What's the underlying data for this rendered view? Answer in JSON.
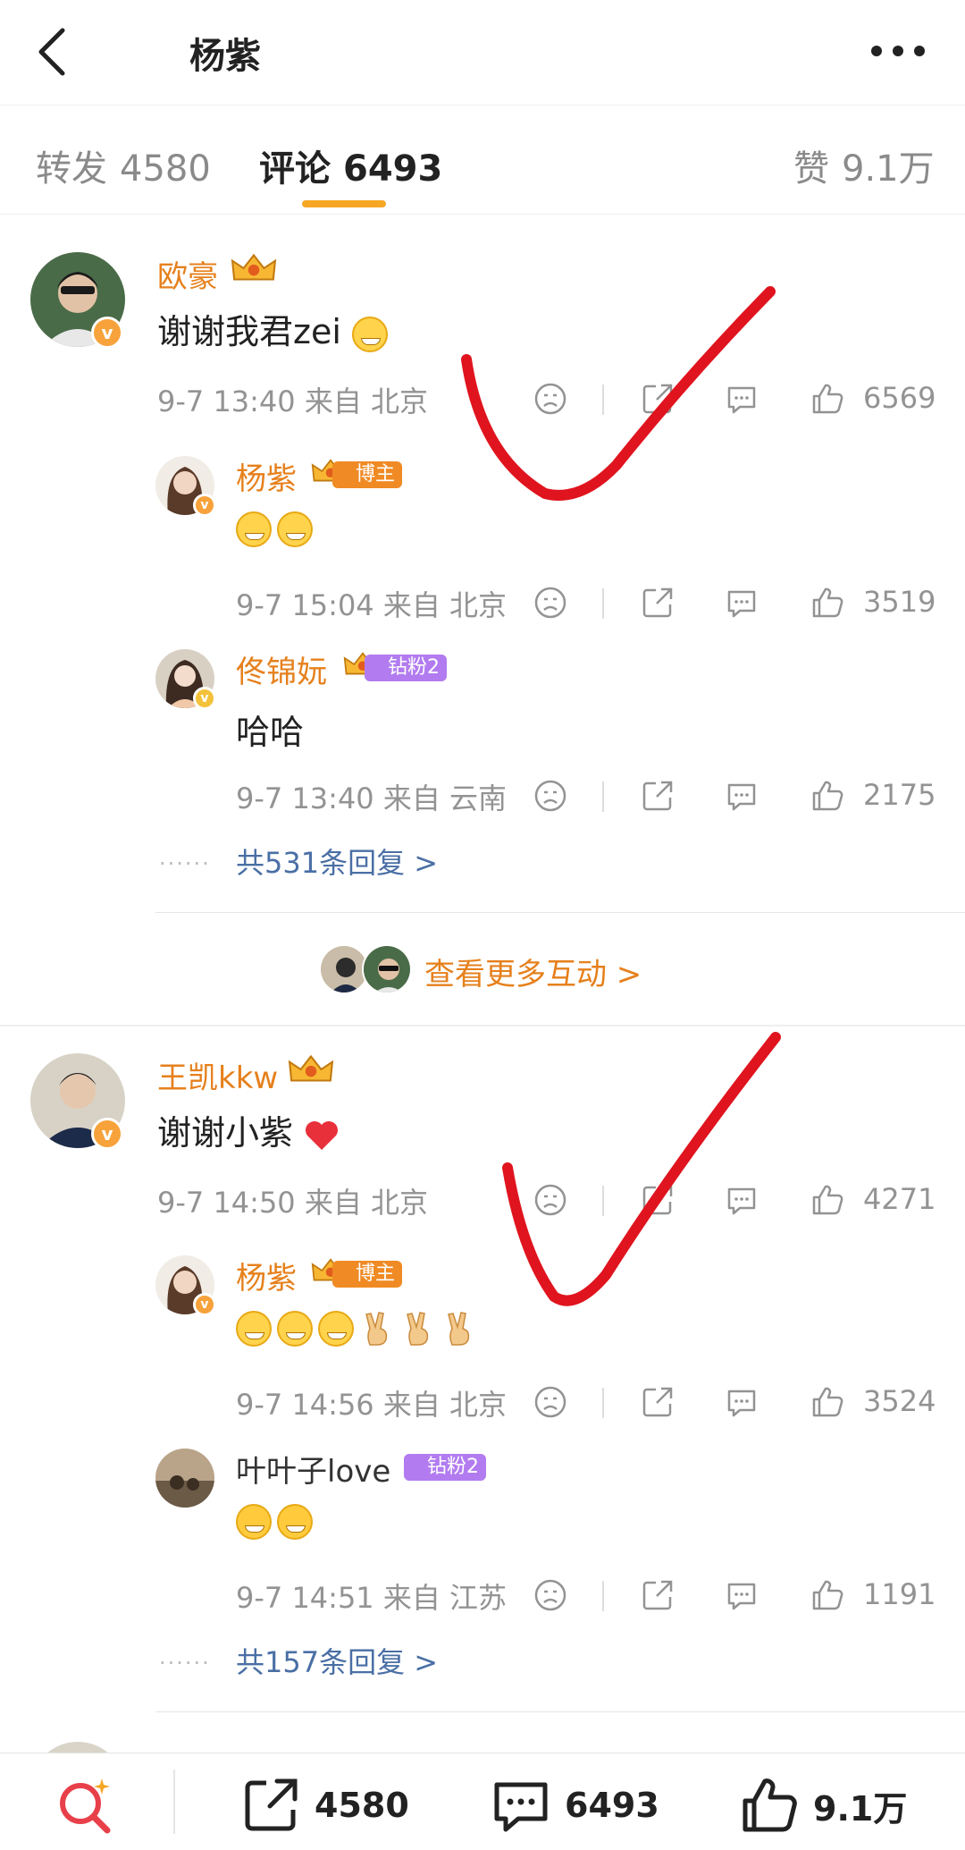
{
  "header": {
    "title": "杨紫"
  },
  "tabs": [
    {
      "label": "转发",
      "count": "4580"
    },
    {
      "label": "评论",
      "count": "6493"
    },
    {
      "label": "赞",
      "count": "9.1万"
    }
  ],
  "comments": [
    {
      "user": "欧豪",
      "level": "10",
      "text": "谢谢我君zei",
      "time": "9-7 13:40",
      "location": "来自 北京",
      "likes": "6569",
      "replies": [
        {
          "user": "杨紫",
          "tag": "博主",
          "level": "9",
          "time": "9-7 15:04",
          "location": "来自 北京",
          "likes": "3519"
        },
        {
          "user": "佟锦妧",
          "tag": "钻粉2",
          "level": "6",
          "text": "哈哈",
          "time": "9-7 13:40",
          "location": "来自 云南",
          "likes": "2175"
        }
      ],
      "reply_summary": "共531条回复 >"
    },
    {
      "user": "王凯kkw",
      "level": "10",
      "text": "谢谢小紫",
      "time": "9-7 14:50",
      "location": "来自 北京",
      "likes": "4271",
      "replies": [
        {
          "user": "杨紫",
          "tag": "博主",
          "level": "9",
          "time": "9-7 14:56",
          "location": "来自 北京",
          "likes": "3524"
        },
        {
          "user": "叶叶子love",
          "tag": "钻粉2",
          "time": "9-7 14:51",
          "location": "来自 江苏",
          "likes": "1191"
        }
      ],
      "reply_summary": "共157条回复 >"
    }
  ],
  "more_interactions": "查看更多互动 >",
  "bottom_bar": {
    "share_count": "4580",
    "comment_count": "6493",
    "like_count": "9.1万"
  },
  "colors": {
    "accent": "#e6801c",
    "tab_underline": "#f6a623",
    "link": "#4a6fa5",
    "check_mark": "#e0141e"
  }
}
